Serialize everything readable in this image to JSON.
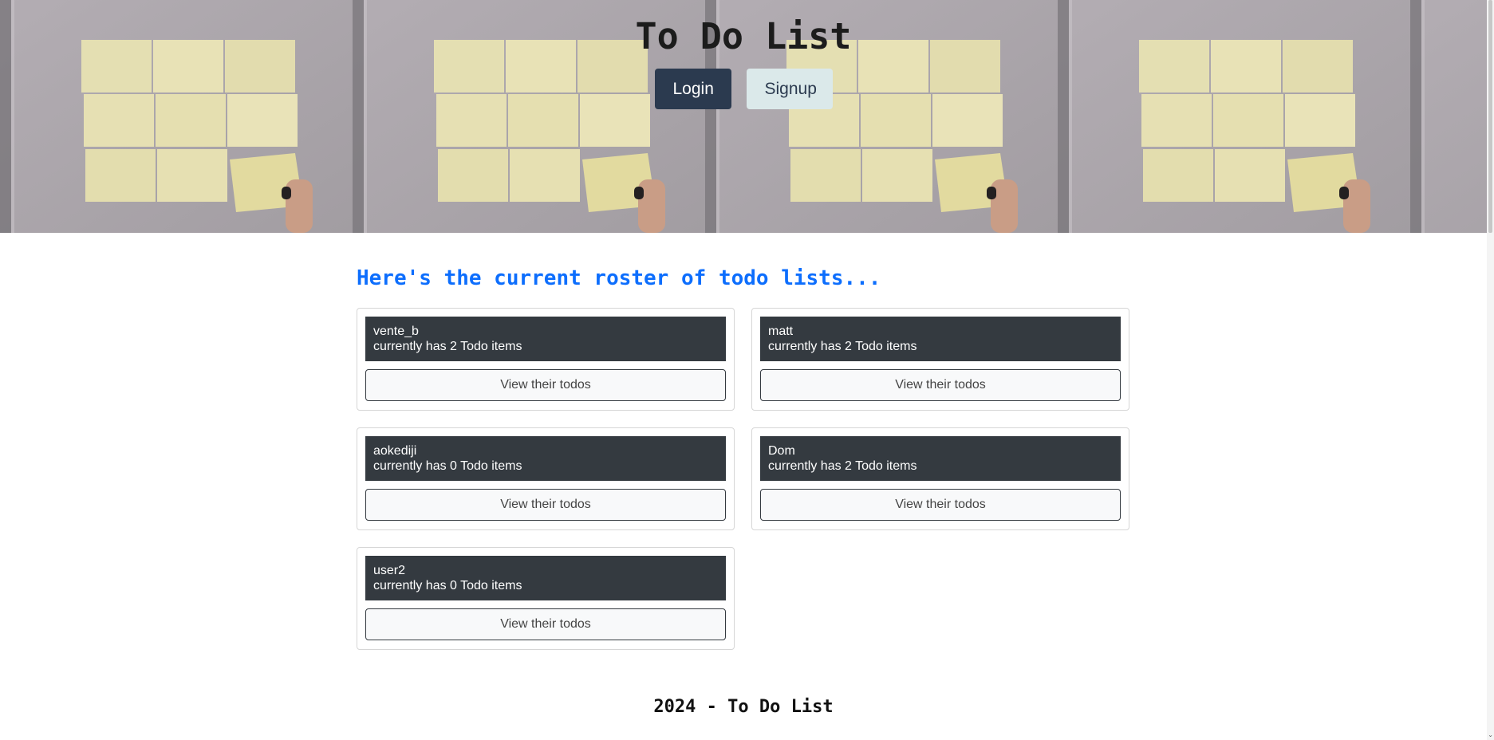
{
  "header": {
    "title": "To Do List",
    "login_label": "Login",
    "signup_label": "Signup"
  },
  "main": {
    "heading": "Here's the current roster of todo lists...",
    "cards": [
      {
        "username": "vente_b",
        "summary": "currently has 2 Todo items",
        "button_label": "View their todos"
      },
      {
        "username": "matt",
        "summary": "currently has 2 Todo items",
        "button_label": "View their todos"
      },
      {
        "username": "aokediji",
        "summary": "currently has 0 Todo items",
        "button_label": "View their todos"
      },
      {
        "username": "Dom",
        "summary": "currently has 2 Todo items",
        "button_label": "View their todos"
      },
      {
        "username": "user2",
        "summary": "currently has 0 Todo items",
        "button_label": "View their todos"
      }
    ]
  },
  "footer": {
    "text": "2024 - To Do List"
  },
  "colors": {
    "heading_accent": "#0d6efd",
    "login_button": "#2b3a4f",
    "signup_button": "#dbe9ea",
    "card_header": "#343a40"
  },
  "icons": {
    "scroll_down": "chevron-down-icon"
  }
}
